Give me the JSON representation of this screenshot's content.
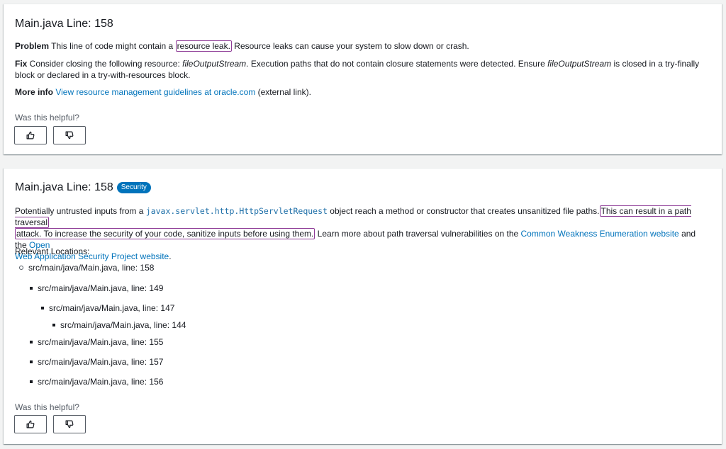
{
  "card1": {
    "title": "Main.java Line: 158",
    "problem_label": "Problem",
    "problem_text_before": " This line of code might contain a ",
    "problem_highlight": "resource leak.",
    "problem_text_after": " Resource leaks can cause your system to slow down or crash.",
    "fix_label": "Fix",
    "fix_text_1": " Consider closing the following resource: ",
    "fix_resource_1": "fileOutputStream",
    "fix_text_2": ". Execution paths that do not contain closure statements were detected. Ensure ",
    "fix_resource_2": "fileOutputStream",
    "fix_text_3": " is closed in a try-finally block or declared in a try-with-resources block.",
    "more_info_label": "More info",
    "more_info_link": "View resource management guidelines at oracle.com",
    "more_info_after": " (external link).",
    "helpful_prompt": "Was this helpful?"
  },
  "card2": {
    "title": "Main.java Line: 158",
    "badge": "Security",
    "desc_1": "Potentially untrusted inputs from a ",
    "desc_code": "javax.servlet.http.HttpServletRequest",
    "desc_2": " object reach a method or constructor that creates unsanitized file paths.",
    "desc_highlight_1": "This can result in a path traversal",
    "desc_highlight_2": "attack. To increase the security of your code, sanitize inputs before using them.",
    "desc_3": " Learn more about path traversal vulnerabilities on the ",
    "desc_link_1": "Common Weakness Enumeration website",
    "desc_4": " and the ",
    "desc_link_2a": "Open",
    "desc_link_2b": "Web Application Security Project website",
    "desc_5": ".",
    "relevant_label": "Relevant Locations:",
    "locations": [
      "src/main/java/Main.java, line: 158",
      "src/main/java/Main.java, line: 149",
      "src/main/java/Main.java, line: 147",
      "src/main/java/Main.java, line: 144",
      "src/main/java/Main.java, line: 155",
      "src/main/java/Main.java, line: 157",
      "src/main/java/Main.java, line: 156"
    ],
    "helpful_prompt": "Was this helpful?"
  },
  "icons": {
    "thumbs_up": "thumbs-up-icon",
    "thumbs_down": "thumbs-down-icon"
  },
  "colors": {
    "link": "#0073bb",
    "badge": "#0073bb",
    "highlight_border": "#8d3a96",
    "code": "#1e6fa8",
    "page_bg": "#f2f3f3"
  }
}
